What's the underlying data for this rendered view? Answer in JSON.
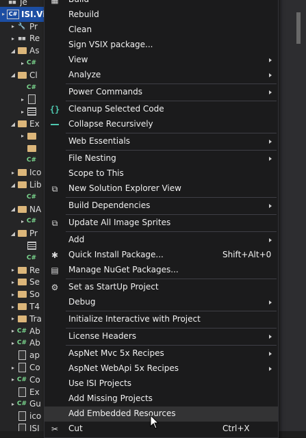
{
  "tree": {
    "items": [
      {
        "expander": "",
        "icon": "ref",
        "label": "Je"
      },
      {
        "expander": "▸",
        "icon": "sln",
        "label": "ISI.Vi",
        "selected": true
      },
      {
        "expander": "▸",
        "icon": "wrench",
        "label": "Pr"
      },
      {
        "expander": "▸",
        "icon": "ref",
        "label": "Re"
      },
      {
        "expander": "◢",
        "icon": "folder",
        "label": "As"
      },
      {
        "expander": "▸",
        "icon": "cs",
        "label": ""
      },
      {
        "expander": "◢",
        "icon": "folder",
        "label": "Cl"
      },
      {
        "expander": "",
        "icon": "cs",
        "label": ""
      },
      {
        "expander": "▸",
        "icon": "file",
        "label": ""
      },
      {
        "expander": "▸",
        "icon": "grid",
        "label": ""
      },
      {
        "expander": "◢",
        "icon": "folder",
        "label": "Ex"
      },
      {
        "expander": "▸",
        "icon": "folder",
        "label": ""
      },
      {
        "expander": "",
        "icon": "folder",
        "label": ""
      },
      {
        "expander": "",
        "icon": "cs",
        "label": ""
      },
      {
        "expander": "▸",
        "icon": "folder",
        "label": "Ico"
      },
      {
        "expander": "◢",
        "icon": "folder",
        "label": "Lib"
      },
      {
        "expander": "",
        "icon": "cs",
        "label": ""
      },
      {
        "expander": "◢",
        "icon": "folder",
        "label": "NA"
      },
      {
        "expander": "▸",
        "icon": "cs",
        "label": ""
      },
      {
        "expander": "◢",
        "icon": "folder",
        "label": "Pr"
      },
      {
        "expander": "",
        "icon": "grid",
        "label": ""
      },
      {
        "expander": "",
        "icon": "cs",
        "label": ""
      },
      {
        "expander": "▸",
        "icon": "folder",
        "label": "Re"
      },
      {
        "expander": "▸",
        "icon": "folder",
        "label": "Se"
      },
      {
        "expander": "▸",
        "icon": "folder",
        "label": "So"
      },
      {
        "expander": "▸",
        "icon": "folder",
        "label": "T4"
      },
      {
        "expander": "▸",
        "icon": "folder",
        "label": "Tra"
      },
      {
        "expander": "▸",
        "icon": "cs",
        "label": "Ab"
      },
      {
        "expander": "▸",
        "icon": "cs",
        "label": "Ab"
      },
      {
        "expander": "",
        "icon": "file",
        "label": "ap"
      },
      {
        "expander": "▸",
        "icon": "file",
        "label": "Co"
      },
      {
        "expander": "▸",
        "icon": "cs",
        "label": "Co"
      },
      {
        "expander": "",
        "icon": "file",
        "label": "Ex"
      },
      {
        "expander": "▸",
        "icon": "cs",
        "label": "Gu"
      },
      {
        "expander": "",
        "icon": "file",
        "label": "ico"
      },
      {
        "expander": "",
        "icon": "file",
        "label": "ISI"
      }
    ]
  },
  "menu": {
    "items": [
      {
        "label": "Build",
        "icon": "build-icon",
        "glyph": "▦"
      },
      {
        "label": "Rebuild"
      },
      {
        "label": "Clean"
      },
      {
        "label": "Sign VSIX package..."
      },
      {
        "label": "View",
        "submenu": true
      },
      {
        "label": "Analyze",
        "submenu": true
      },
      {
        "separator": true
      },
      {
        "label": "Power Commands",
        "submenu": true
      },
      {
        "separator": true
      },
      {
        "label": "Cleanup Selected Code",
        "icon": "curly-braces-icon",
        "glyph": "{}"
      },
      {
        "label": "Collapse Recursively",
        "icon": "collapse-icon",
        "glyph": ""
      },
      {
        "separator": true
      },
      {
        "label": "Web Essentials",
        "submenu": true
      },
      {
        "separator": true
      },
      {
        "label": "File Nesting",
        "submenu": true
      },
      {
        "label": "Scope to This"
      },
      {
        "label": "New Solution Explorer View",
        "icon": "new-window-icon",
        "glyph": "⧉"
      },
      {
        "separator": true
      },
      {
        "label": "Build Dependencies",
        "submenu": true
      },
      {
        "separator": true
      },
      {
        "label": "Update All Image Sprites",
        "icon": "sprites-icon",
        "glyph": "⧉"
      },
      {
        "separator": true
      },
      {
        "label": "Add",
        "submenu": true
      },
      {
        "label": "Quick Install Package...",
        "icon": "package-icon",
        "glyph": "✱",
        "shortcut": "Shift+Alt+0"
      },
      {
        "label": "Manage NuGet Packages...",
        "icon": "nuget-icon",
        "glyph": "▤"
      },
      {
        "separator": true
      },
      {
        "label": "Set as StartUp Project",
        "icon": "gear-icon",
        "glyph": "⚙"
      },
      {
        "label": "Debug",
        "submenu": true
      },
      {
        "separator": true
      },
      {
        "label": "Initialize Interactive with Project"
      },
      {
        "separator": true
      },
      {
        "label": "License Headers",
        "submenu": true
      },
      {
        "separator": true
      },
      {
        "label": "AspNet Mvc 5x Recipes",
        "submenu": true
      },
      {
        "label": "AspNet WebApi 5x Recipes",
        "submenu": true
      },
      {
        "label": "Use ISI Projects"
      },
      {
        "label": "Add Missing Projects"
      },
      {
        "label": "Add Embedded Resources",
        "hover": true
      },
      {
        "label": "Cut",
        "icon": "scissors-icon",
        "glyph": "✂",
        "shortcut": "Ctrl+X"
      }
    ]
  },
  "colors": {
    "background": "#1e1e1e",
    "menu_background": "#1b1b1c",
    "selection": "#1c4ea3",
    "accent": "#4ec9b0"
  }
}
